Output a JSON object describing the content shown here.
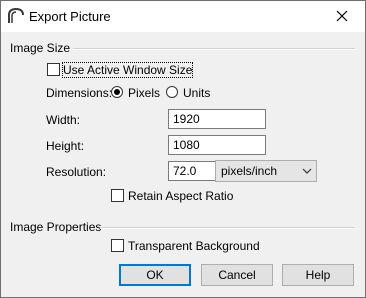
{
  "window": {
    "title": "Export Picture"
  },
  "image_size": {
    "section_label": "Image Size",
    "use_active_window": {
      "label": "Use Active Window Size",
      "checked": false
    },
    "dimensions": {
      "label": "Dimensions:",
      "options": [
        {
          "label": "Pixels",
          "selected": true
        },
        {
          "label": "Units",
          "selected": false
        }
      ]
    },
    "width": {
      "label": "Width:",
      "value": "1920"
    },
    "height": {
      "label": "Height:",
      "value": "1080"
    },
    "resolution": {
      "label": "Resolution:",
      "value": "72.0",
      "unit": "pixels/inch"
    },
    "retain_aspect": {
      "label": "Retain Aspect Ratio",
      "checked": false
    }
  },
  "image_properties": {
    "section_label": "Image Properties",
    "transparent_background": {
      "label": "Transparent Background",
      "checked": false
    }
  },
  "buttons": {
    "ok": "OK",
    "cancel": "Cancel",
    "help": "Help"
  },
  "colors": {
    "dialog_bg": "#f0f0f0",
    "default_button_border": "#0078d7"
  }
}
